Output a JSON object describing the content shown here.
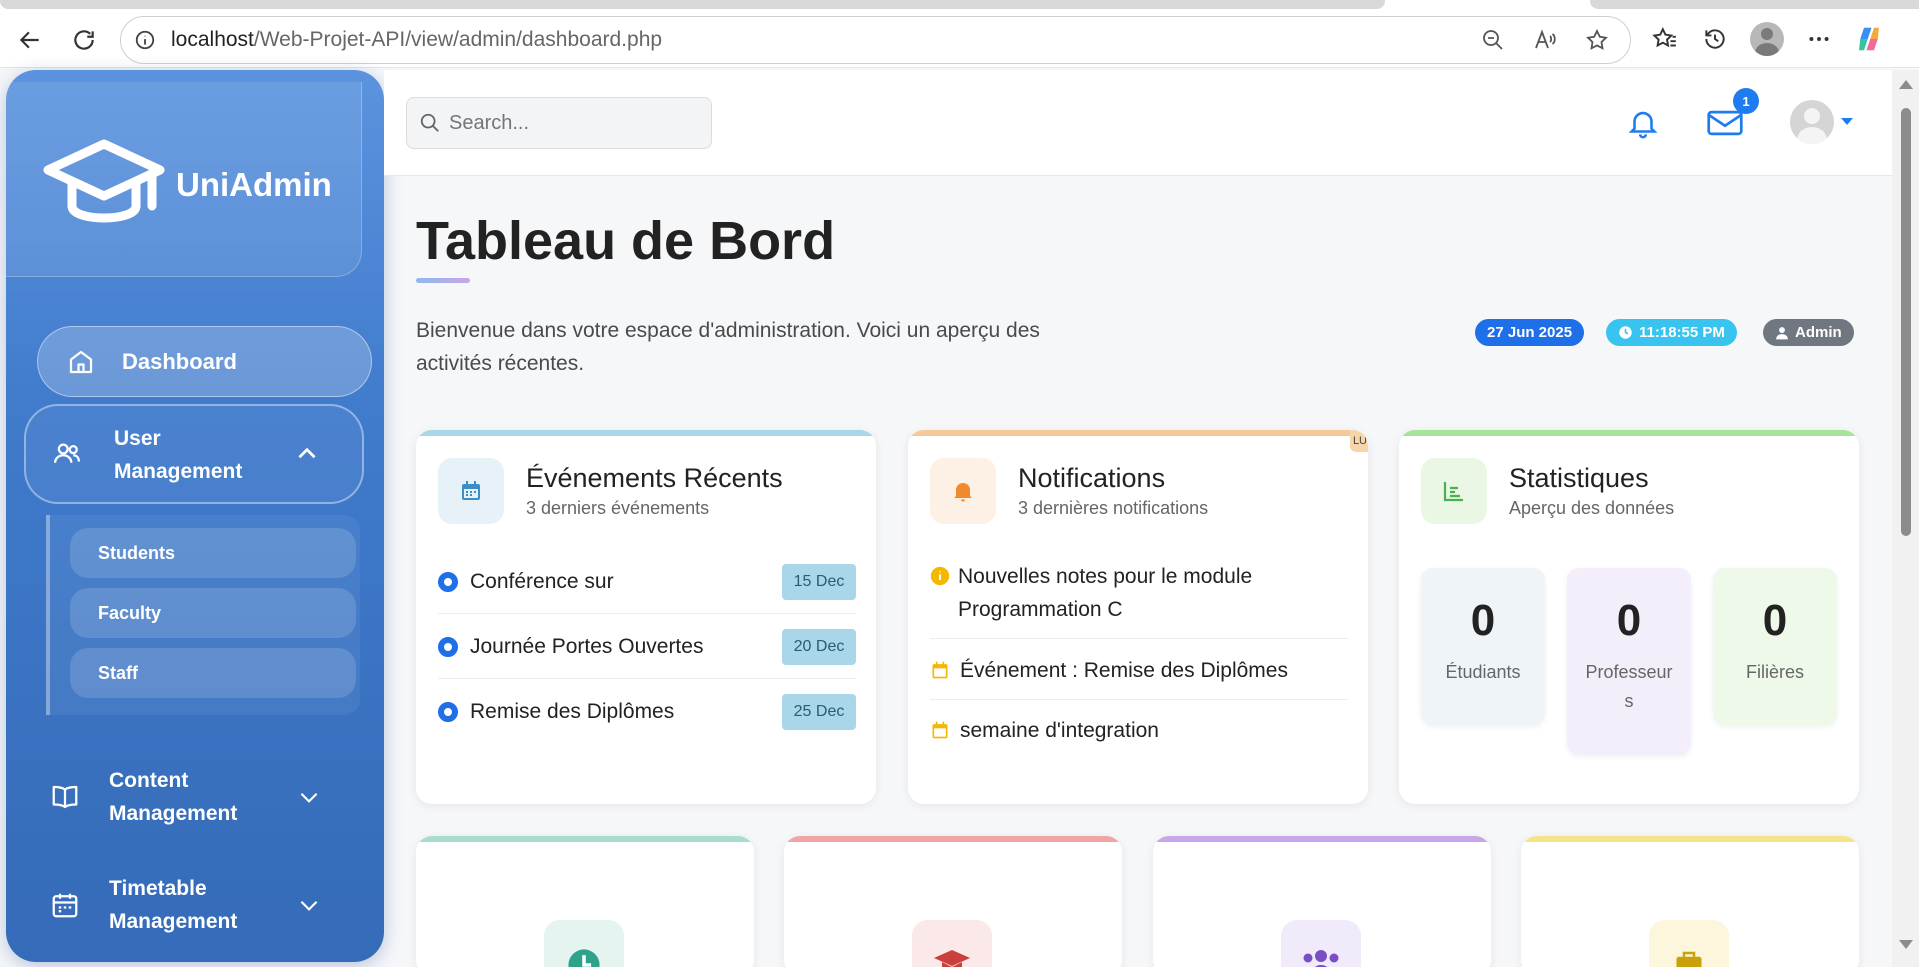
{
  "browser": {
    "url_host": "localhost",
    "url_path": "/Web-Projet-API/view/admin/dashboard.php"
  },
  "sidebar": {
    "brand": "UniAdmin",
    "dashboard_label": "Dashboard",
    "groups": [
      {
        "label": "User Management",
        "icon": "users-icon",
        "expanded": true,
        "items": [
          "Students",
          "Faculty",
          "Staff"
        ]
      },
      {
        "label": "Content Management",
        "icon": "book-icon",
        "expanded": false
      },
      {
        "label": "Timetable Management",
        "icon": "calendar-icon",
        "expanded": false
      }
    ]
  },
  "header": {
    "search_placeholder": "Search...",
    "mail_badge": "1"
  },
  "main": {
    "title": "Tableau de Bord",
    "welcome": "Bienvenue dans votre espace d'administration. Voici un aperçu des activités récentes.",
    "date_pill": "27 Jun 2025",
    "time_pill": "11:18:55 PM",
    "role_pill": "Admin"
  },
  "events": {
    "title": "Événements Récents",
    "subtitle": "3 derniers événements",
    "items": [
      {
        "name": "Conférence sur",
        "date": "15 Dec"
      },
      {
        "name": "Journée Portes Ouvertes",
        "date": "20 Dec"
      },
      {
        "name": "Remise des Diplômes",
        "date": "25 Dec"
      }
    ]
  },
  "notifications": {
    "title": "Notifications",
    "subtitle": "3 dernières notifications",
    "corner_tag": "LU",
    "items": [
      {
        "text": "Nouvelles notes pour le module Programmation C",
        "icon": "info-icon"
      },
      {
        "text": "Événement : Remise des Diplômes",
        "icon": "calendar-icon"
      },
      {
        "text": "semaine d'integration",
        "icon": "calendar-icon"
      }
    ]
  },
  "stats": {
    "title": "Statistiques",
    "subtitle": "Aperçu des données",
    "items": [
      {
        "value": "0",
        "label": "Étudiants"
      },
      {
        "value": "0",
        "label": "Professeurs"
      },
      {
        "value": "0",
        "label": "Filières"
      }
    ]
  },
  "colors": {
    "primary": "#1e6fe8",
    "sidebar_top": "#5b93de",
    "sidebar_bottom": "#356bb8",
    "events_accent": "#a9d6e8",
    "notifications_accent": "#f6c99a",
    "stats_accent": "#a8e39a"
  }
}
